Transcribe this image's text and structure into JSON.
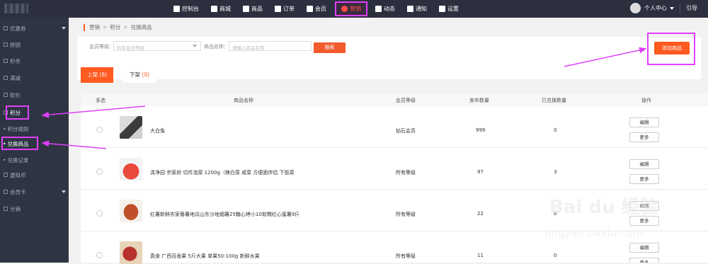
{
  "nav": [
    {
      "label": "控制台",
      "icon": "home-icon"
    },
    {
      "label": "商城",
      "icon": "store-icon"
    },
    {
      "label": "商品",
      "icon": "goods-icon"
    },
    {
      "label": "订单",
      "icon": "order-icon"
    },
    {
      "label": "会员",
      "icon": "member-icon"
    },
    {
      "label": "营销",
      "icon": "marketing-icon"
    },
    {
      "label": "动态",
      "icon": "chart-icon"
    },
    {
      "label": "通知",
      "icon": "bell-icon"
    },
    {
      "label": "设置",
      "icon": "gear-icon"
    }
  ],
  "user": {
    "label": "个人中心",
    "extra": "引导"
  },
  "sidebar": {
    "items": [
      "优惠券",
      "拼团",
      "秒杀",
      "满减",
      "砍价",
      "积分",
      "虚拟币",
      "会员卡",
      "分销"
    ],
    "sub": [
      "积分规则",
      "兑换商品",
      "兑换记录"
    ]
  },
  "breadcrumb": [
    "营销",
    "积分",
    "兑换商品"
  ],
  "filter": {
    "level_label": "会员等级：",
    "level_placeholder": "所有会员等级",
    "name_label": "商品名称：",
    "name_placeholder": "请输入商品名称",
    "search_btn": "搜索",
    "add_btn": "添加商品"
  },
  "tabs": [
    {
      "label": "上架",
      "count": "(6)"
    },
    {
      "label": "下架",
      "count": "(0)"
    }
  ],
  "table": {
    "headers": [
      "多选",
      "商品名称",
      "会员等级",
      "发布数量",
      "已兑换数量",
      "操作"
    ],
    "rows": [
      {
        "name": "大白兔",
        "level": "钻石会员",
        "qty": "999",
        "done": "0",
        "edit": "编辑",
        "more": "更多"
      },
      {
        "name": "清净园 宗家府 切件泡菜 1200g（辣白菜 咸菜 方便面伴侣 下饭菜",
        "level": "所有等级",
        "qty": "97",
        "done": "3",
        "edit": "编辑",
        "more": "更多"
      },
      {
        "name": "红薯新鲜农家番薯地瓜山东沙地烟薯25糖心烤小10软糯红心蜜薯9斤",
        "level": "所有等级",
        "qty": "22",
        "done": "0",
        "edit": "编辑",
        "more": "更多"
      },
      {
        "name": "真食 广西百香果 5斤大果 单果50-100g 新鲜水果",
        "level": "所有等级",
        "qty": "11",
        "done": "0",
        "edit": "编辑",
        "more": "更多"
      }
    ]
  },
  "watermark": {
    "brand": "Bai du 经验",
    "url": "jingyan.baidu.com"
  }
}
